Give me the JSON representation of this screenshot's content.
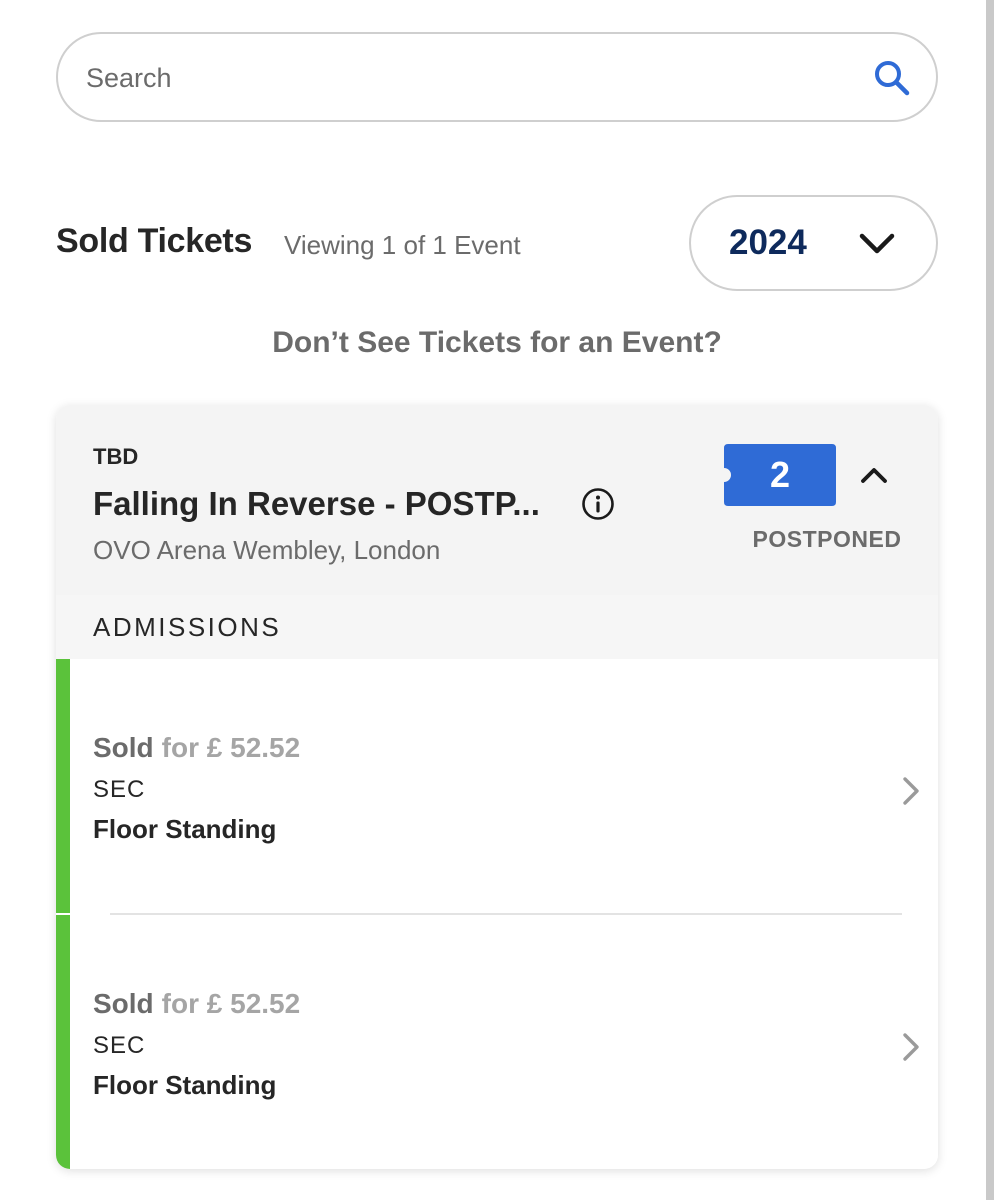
{
  "search": {
    "placeholder": "Search",
    "icon": "search-icon"
  },
  "header": {
    "title": "Sold Tickets",
    "viewing": "Viewing 1 of 1 Event",
    "year_selected": "2024"
  },
  "help_link": "Don’t See Tickets for an Event?",
  "event": {
    "date": "TBD",
    "name": "Falling In Reverse - POSTP...",
    "venue": "OVO Arena Wembley, London",
    "ticket_count": "2",
    "status": "POSTPONED",
    "section_heading": "ADMISSIONS",
    "tickets": [
      {
        "status": "Sold",
        "price": "for £ 52.52",
        "sec_label": "SEC",
        "section": "Floor Standing"
      },
      {
        "status": "Sold",
        "price": "for £ 52.52",
        "sec_label": "SEC",
        "section": "Floor Standing"
      }
    ]
  },
  "colors": {
    "accent_blue": "#2f6bd6",
    "year_text": "#0e2a5c",
    "sold_green": "#5bc23b",
    "muted_text": "#6b6b6b"
  }
}
